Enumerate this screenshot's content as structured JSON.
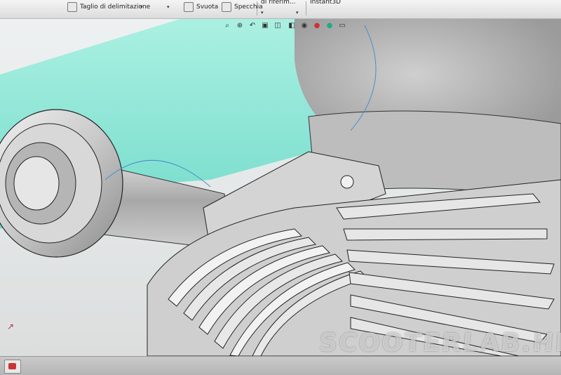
{
  "toolbar": {
    "items": [
      {
        "label": "Taglio di delimitazione"
      },
      {
        "label": "Svuota"
      },
      {
        "label": "Specchia"
      },
      {
        "label": "di riferim..."
      },
      {
        "label": "Instant3D"
      }
    ]
  },
  "heads_up_toolbar": {
    "icons": [
      "zoom-fit-icon",
      "zoom-area-icon",
      "previous-view-icon",
      "section-view-icon",
      "view-orientation-icon",
      "display-style-icon",
      "hide-show-icon",
      "edit-appearance-icon",
      "apply-scene-icon",
      "view-settings-icon"
    ]
  },
  "viewport": {
    "model_color": "#c8c8c8",
    "highlight_color": "#7ee6d2",
    "edge_color": "#222222"
  },
  "watermark": {
    "text": "SCOOTERLAB.HK"
  }
}
